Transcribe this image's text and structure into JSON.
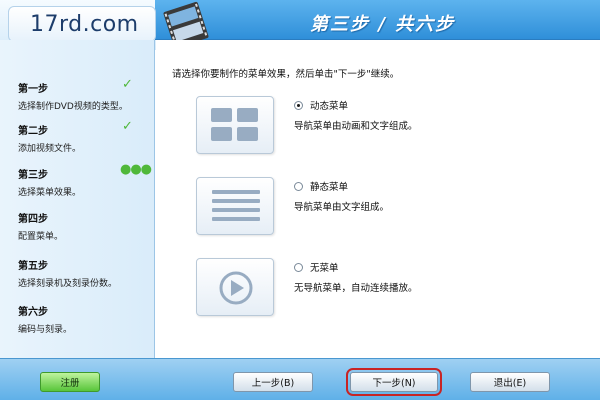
{
  "header": {
    "logo_text": "17rd.com",
    "step_title": "第三步 / 共六步"
  },
  "sidebar": {
    "steps": [
      {
        "title": "第一步",
        "desc": "选择制作DVD视频的类型。",
        "status": "done"
      },
      {
        "title": "第二步",
        "desc": "添加视频文件。",
        "status": "done"
      },
      {
        "title": "第三步",
        "desc": "选择菜单效果。",
        "status": "current"
      },
      {
        "title": "第四步",
        "desc": "配置菜单。",
        "status": "pending"
      },
      {
        "title": "第五步",
        "desc": "选择刻录机及刻录份数。",
        "status": "pending"
      },
      {
        "title": "第六步",
        "desc": "编码与刻录。",
        "status": "pending"
      }
    ]
  },
  "main": {
    "instruction": "请选择你要制作的菜单效果，然后单击\"下一步\"继续。",
    "options": [
      {
        "label": "动态菜单",
        "desc": "导航菜单由动画和文字组成。",
        "checked": true,
        "icon": "grid-icon"
      },
      {
        "label": "静态菜单",
        "desc": "导航菜单由文字组成。",
        "checked": false,
        "icon": "list-lines-icon"
      },
      {
        "label": "无菜单",
        "desc": "无导航菜单，自动连续播放。",
        "checked": false,
        "icon": "play-icon"
      }
    ]
  },
  "footer": {
    "register": "注册",
    "prev": "上一步(B)",
    "next": "下一步(N)",
    "exit": "退出(E)"
  },
  "colors": {
    "accent": "#2f8fd9",
    "check": "#4fb83a",
    "register": "#58c53a",
    "focus_outline": "#c82424"
  }
}
